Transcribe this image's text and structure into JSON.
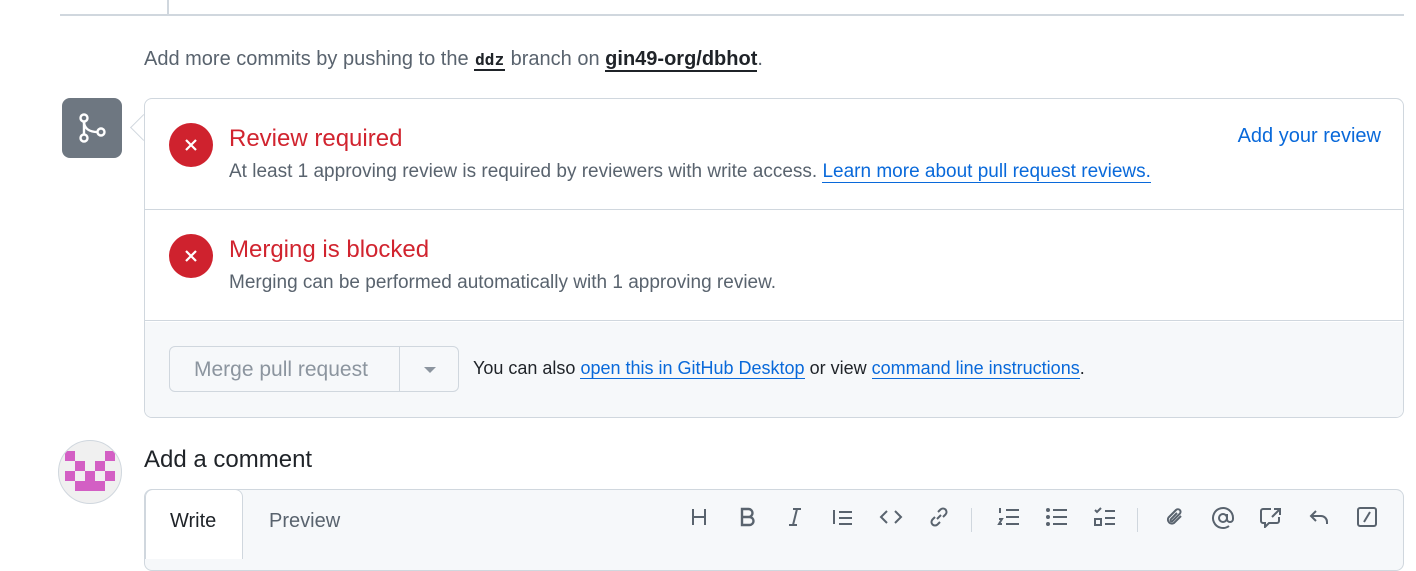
{
  "hint": {
    "prefix": "Add more commits by pushing to the",
    "branch": "ddz",
    "middle": "branch on",
    "repo": "gin49-org/dbhot",
    "suffix": "."
  },
  "review": {
    "title": "Review required",
    "desc": "At least 1 approving review is required by reviewers with write access.",
    "link": "Learn more about pull request reviews.",
    "action": "Add your review"
  },
  "blocked": {
    "title": "Merging is blocked",
    "desc": "Merging can be performed automatically with 1 approving review."
  },
  "merge": {
    "button_label": "Merge pull request",
    "also_prefix": "You can also",
    "desktop_link": "open this in GitHub Desktop",
    "or_view": "or view",
    "cli_link": "command line instructions",
    "period": "."
  },
  "comment": {
    "title": "Add a comment",
    "tab_write": "Write",
    "tab_preview": "Preview",
    "toolbar": [
      "heading-icon",
      "bold-icon",
      "italic-icon",
      "quote-icon",
      "code-icon",
      "link-icon",
      "ordered-list-icon",
      "unordered-list-icon",
      "task-list-icon",
      "attach-icon",
      "mention-icon",
      "reference-icon",
      "reply-icon",
      "slash-command-icon"
    ]
  },
  "colors": {
    "danger": "#cf222e",
    "link": "#0969da",
    "muted": "#59636e",
    "avatar": "#d35fc4"
  }
}
